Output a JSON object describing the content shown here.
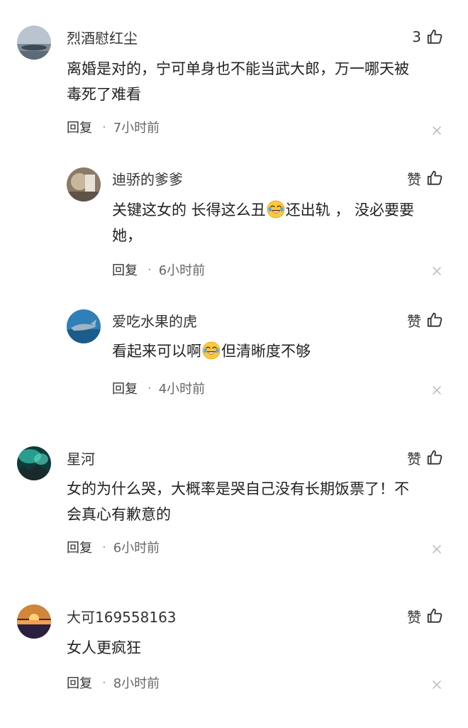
{
  "comments": [
    {
      "username": "烈酒慰红尘",
      "like_label": "3",
      "text_lines": [
        "离婚是对的，宁可单身也不能当武大郎，万一哪天被",
        "毒死了难看"
      ],
      "reply_label": "回复",
      "time": "7小时前"
    },
    {
      "username": "迪骄的爹爹",
      "like_label": "赞",
      "text_parts": [
        "关键这女的 长得这么丑",
        "还出轨 ， 没必要要"
      ],
      "text_line2": "她，",
      "reply_label": "回复",
      "time": "6小时前"
    },
    {
      "username": "爱吃水果的虎",
      "like_label": "赞",
      "text_parts": [
        "看起来可以啊",
        "但清晰度不够"
      ],
      "reply_label": "回复",
      "time": "4小时前"
    },
    {
      "username": "星河",
      "like_label": "赞",
      "text_lines": [
        "女的为什么哭，大概率是哭自己没有长期饭票了！不",
        "会真心有歉意的"
      ],
      "reply_label": "回复",
      "time": "6小时前"
    },
    {
      "username": "大可169558163",
      "like_label": "赞",
      "text_lines": [
        "女人更疯狂"
      ],
      "reply_label": "回复",
      "time": "8小时前"
    }
  ],
  "separator": "·",
  "icons": {
    "like": "thumbs-up-icon",
    "close": "close-icon",
    "emoji": "laughing-crying-emoji-icon"
  },
  "colors": {
    "text": "#222222",
    "meta": "#666666",
    "close": "#c0c0c0"
  }
}
